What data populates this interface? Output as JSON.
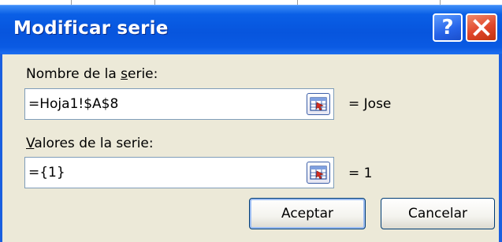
{
  "dialog": {
    "title": "Modificar serie",
    "help_label": "?",
    "icons": {
      "help": "question-mark-icon",
      "close": "close-x-icon",
      "ref": "range-select-icon"
    }
  },
  "series_name": {
    "label_pre": "Nombre de la ",
    "label_hotkey": "s",
    "label_post": "erie:",
    "value": "=Hoja1!$A$8",
    "result": "= Jose"
  },
  "series_values": {
    "label_pre": "",
    "label_hotkey": "V",
    "label_post": "alores de la serie:",
    "value": "={1}",
    "result": "= 1"
  },
  "buttons": {
    "ok": "Aceptar",
    "cancel": "Cancelar"
  },
  "colors": {
    "titlebar": "#0755dd",
    "dialog_bg": "#ece9d8",
    "close": "#e0462a"
  }
}
